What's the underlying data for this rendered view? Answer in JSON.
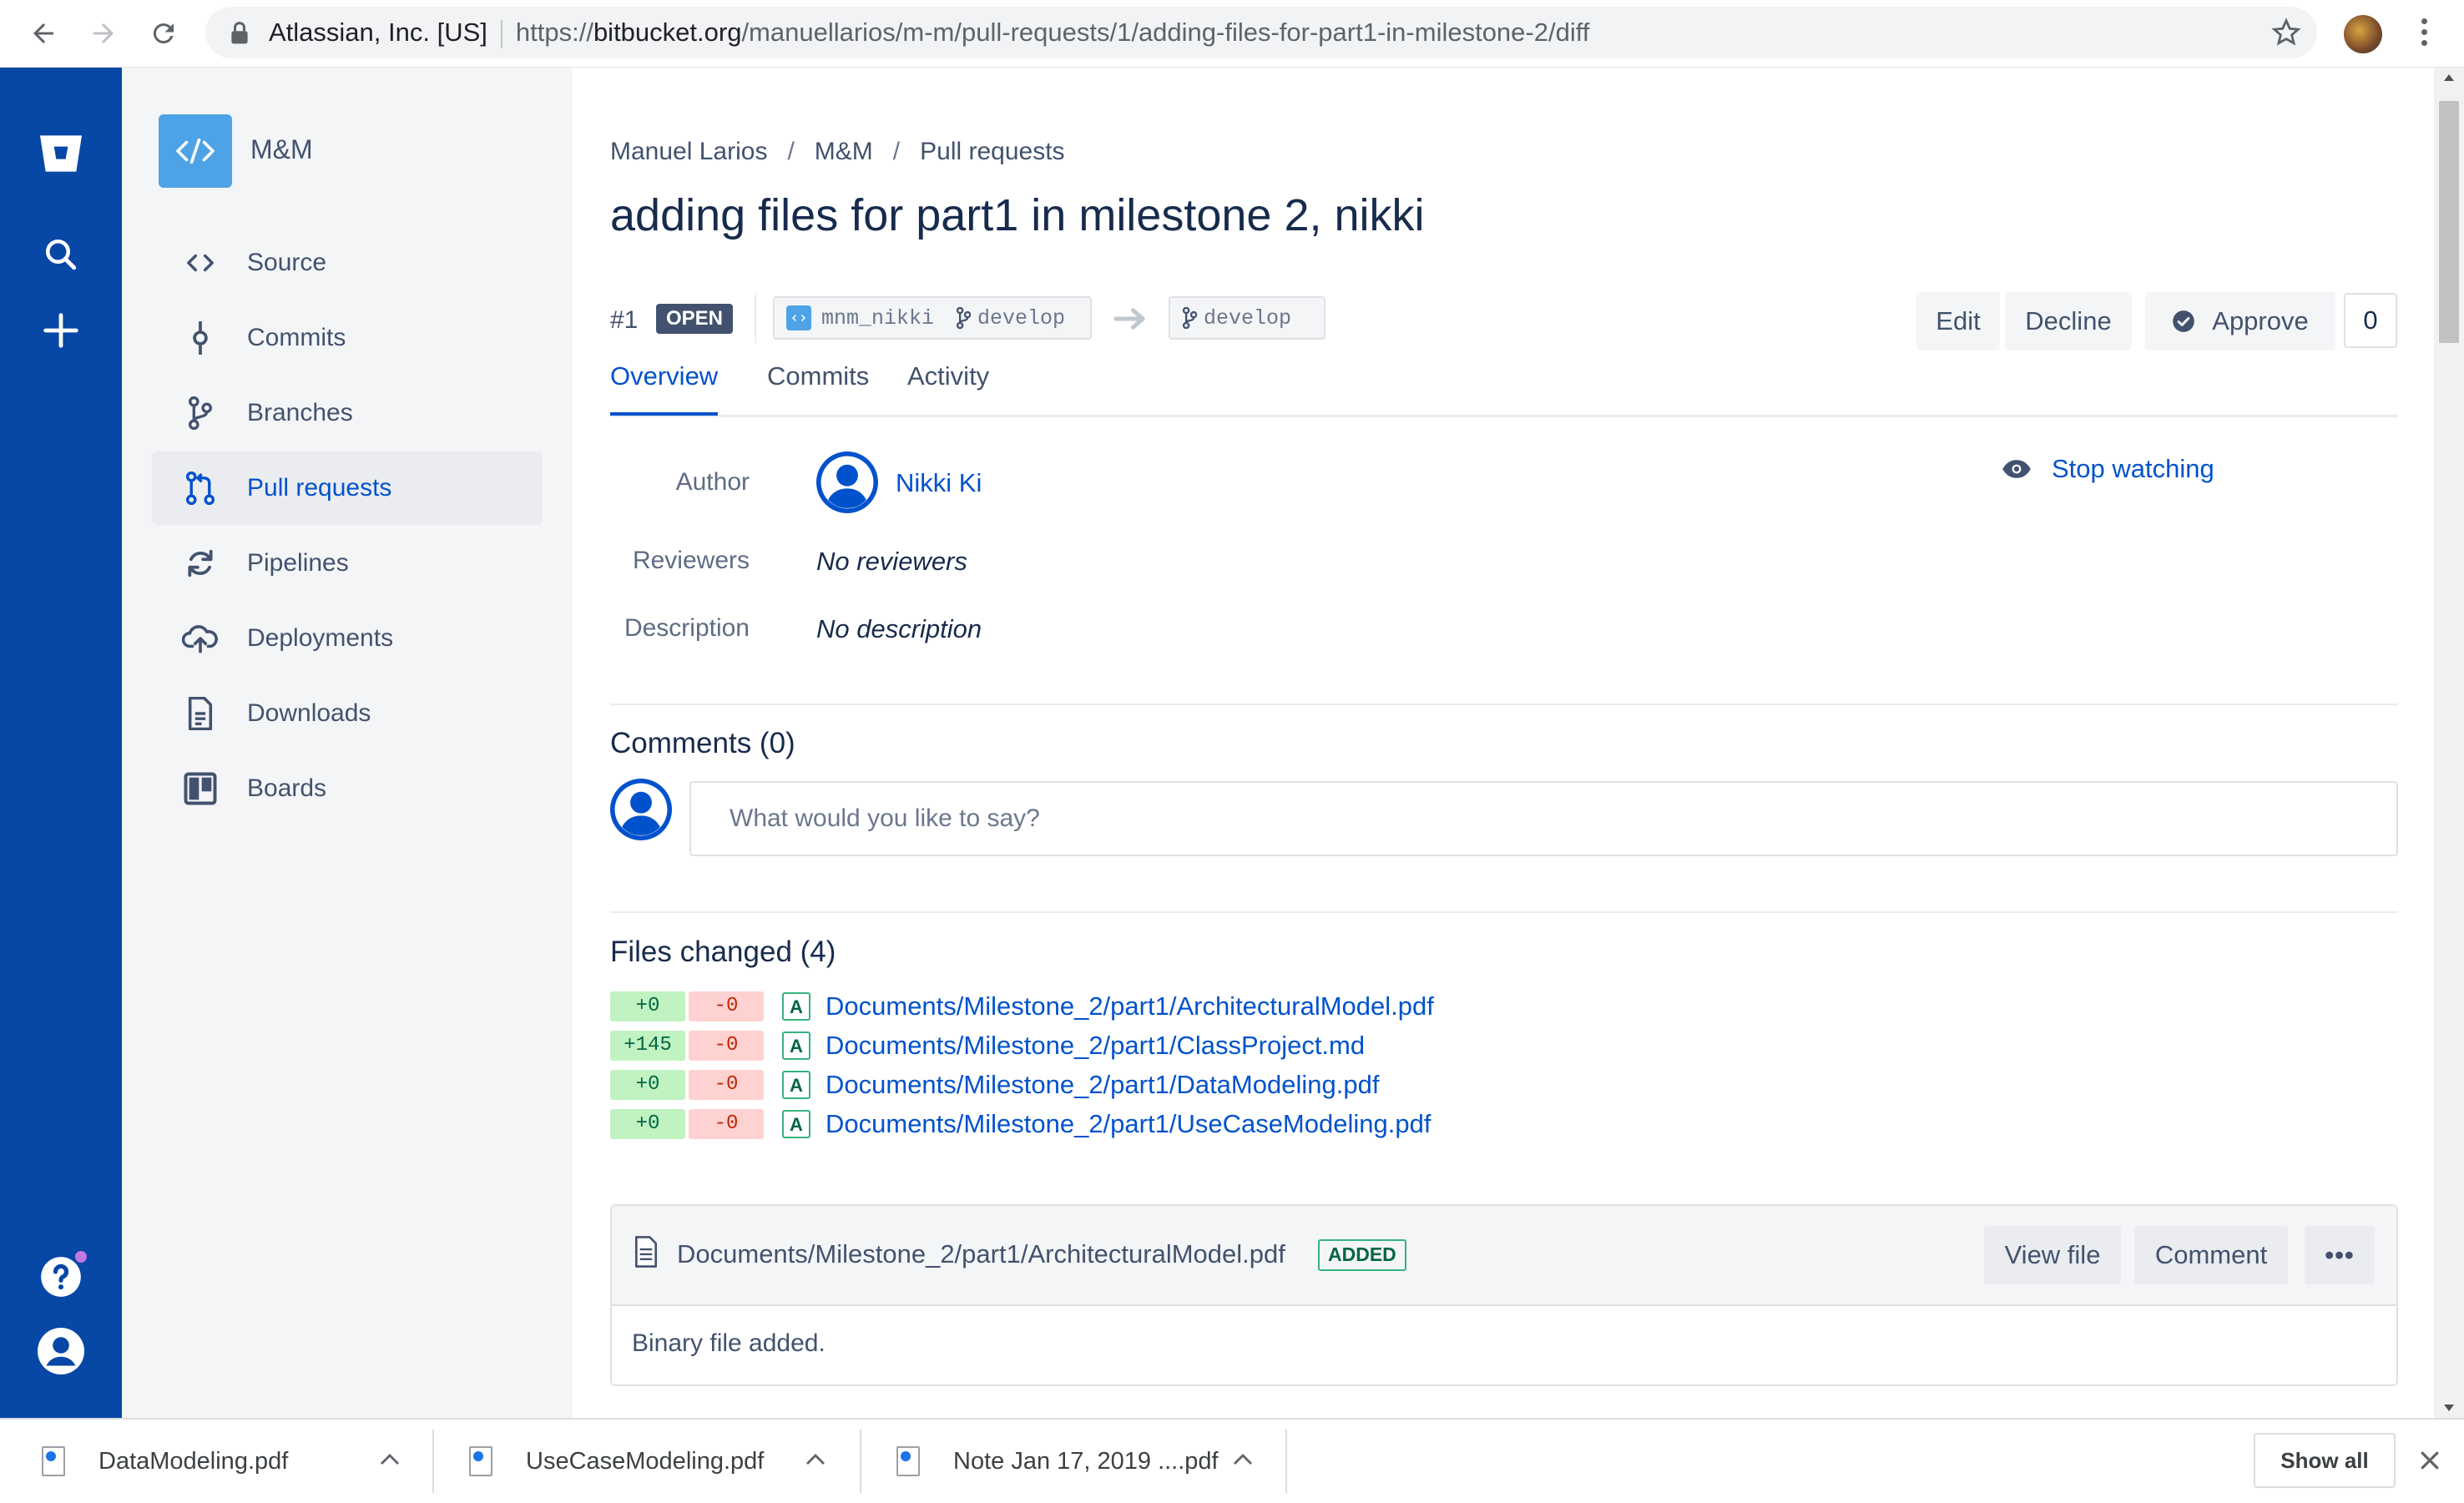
{
  "browser": {
    "org": "Atlassian, Inc. [US]",
    "url_prefix": "https://",
    "url_host": "bitbucket.org",
    "url_path": "/manuellarios/m-m/pull-requests/1/adding-files-for-part1-in-milestone-2/diff"
  },
  "project": {
    "name": "M&M",
    "icon": "code-icon"
  },
  "sidebar": {
    "items": [
      {
        "label": "Source",
        "icon": "source-icon"
      },
      {
        "label": "Commits",
        "icon": "commit-icon"
      },
      {
        "label": "Branches",
        "icon": "branch-icon"
      },
      {
        "label": "Pull requests",
        "icon": "pull-request-icon",
        "active": true
      },
      {
        "label": "Pipelines",
        "icon": "pipelines-icon"
      },
      {
        "label": "Deployments",
        "icon": "cloud-upload-icon"
      },
      {
        "label": "Downloads",
        "icon": "document-icon"
      },
      {
        "label": "Boards",
        "icon": "board-icon"
      }
    ]
  },
  "breadcrumbs": [
    "Manuel Larios",
    "M&M",
    "Pull requests"
  ],
  "breadcrumb_sep": "/",
  "pr": {
    "title": "adding files for part1 in milestone 2, nikki",
    "number": "#1",
    "status": "OPEN",
    "source_repo": "mnm_nikki",
    "source_branch": "develop",
    "dest_branch": "develop",
    "approve_count": "0"
  },
  "actions": {
    "edit": "Edit",
    "decline": "Decline",
    "approve": "Approve"
  },
  "tabs": [
    "Overview",
    "Commits",
    "Activity"
  ],
  "details": {
    "author_label": "Author",
    "author_name": "Nikki Ki",
    "reviewers_label": "Reviewers",
    "reviewers_value": "No reviewers",
    "description_label": "Description",
    "description_value": "No description",
    "watch_label": "Stop watching"
  },
  "comments": {
    "title": "Comments (0)",
    "placeholder": "What would you like to say?"
  },
  "files": {
    "title": "Files changed (4)",
    "list": [
      {
        "added": "+0",
        "removed": "-0",
        "type": "A",
        "path": "Documents/Milestone_2/part1/ArchitecturalModel.pdf"
      },
      {
        "added": "+145",
        "removed": "-0",
        "type": "A",
        "path": "Documents/Milestone_2/part1/ClassProject.md"
      },
      {
        "added": "+0",
        "removed": "-0",
        "type": "A",
        "path": "Documents/Milestone_2/part1/DataModeling.pdf"
      },
      {
        "added": "+0",
        "removed": "-0",
        "type": "A",
        "path": "Documents/Milestone_2/part1/UseCaseModeling.pdf"
      }
    ]
  },
  "diff": {
    "file": "Documents/Milestone_2/part1/ArchitecturalModel.pdf",
    "badge": "ADDED",
    "view_file": "View file",
    "comment": "Comment",
    "more": "•••",
    "body": "Binary file added."
  },
  "downloads": {
    "items": [
      "DataModeling.pdf",
      "UseCaseModeling.pdf",
      "Note Jan 17, 2019 ....pdf"
    ],
    "show_all": "Show all"
  },
  "colors": {
    "global_nav": "#0747a6",
    "link": "#0052cc",
    "added_bg": "#c1f2c1",
    "removed_bg": "#ffd2d2"
  }
}
